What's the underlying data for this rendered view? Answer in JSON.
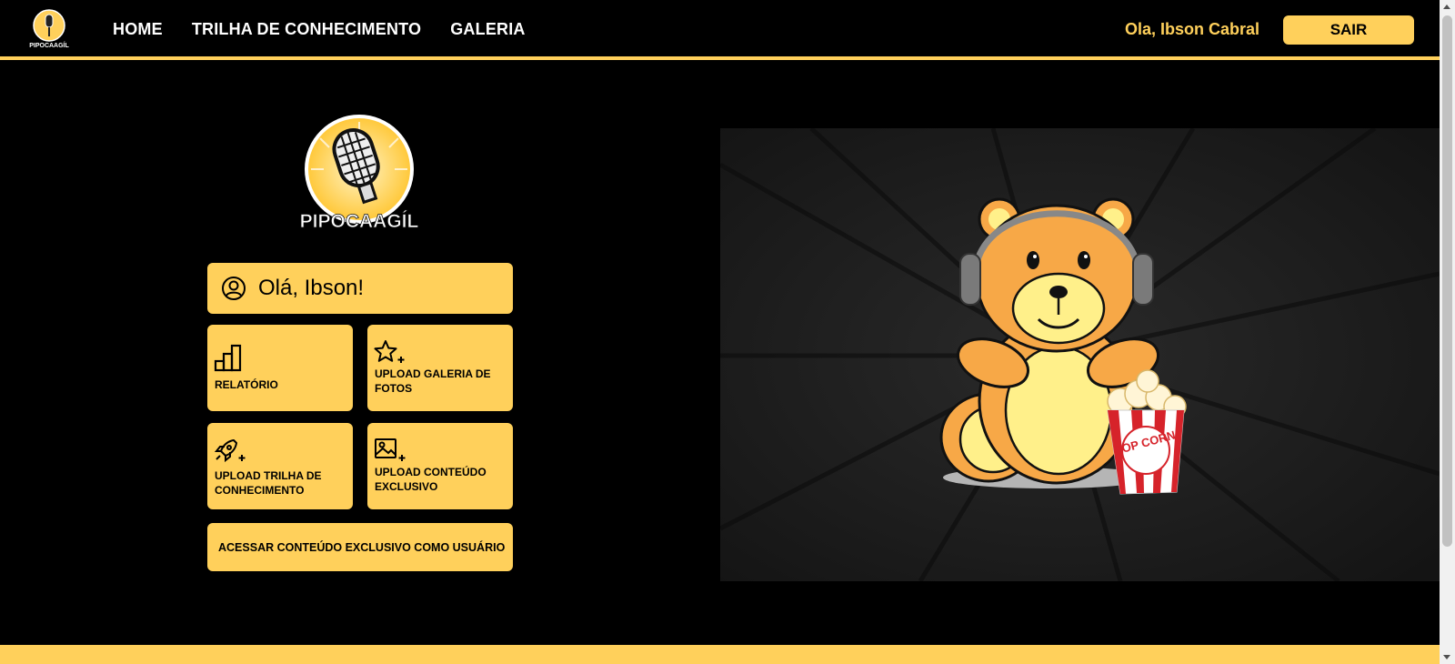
{
  "nav": {
    "links": [
      "HOME",
      "TRILHA DE CONHECIMENTO",
      "GALERIA"
    ],
    "greeting": "Ola, Ibson Cabral",
    "logout_label": "SAIR"
  },
  "brand": {
    "logo_text": "PIPOCAAGÍL"
  },
  "dashboard": {
    "greeting": "Olá, Ibson!",
    "tiles": {
      "report": "RELATÓRIO",
      "upload_gallery": "UPLOAD GALERIA DE FOTOS",
      "upload_trail": "UPLOAD TRILHA DE CONHECIMENTO",
      "upload_exclusive": "UPLOAD CONTEÚDO EXCLUSIVO"
    },
    "exclusive_access": "ACESSAR CONTEÚDO EXCLUSIVO COMO USUÁRIO"
  },
  "hero": {
    "popcorn_text": "POP CORN"
  },
  "colors": {
    "accent": "#FFD05B",
    "background": "#000000",
    "hero_background": "#1b1b1b"
  },
  "icons": [
    "person-circle-icon",
    "bar-chart-icon",
    "star-plus-icon",
    "rocket-plus-icon",
    "image-plus-icon"
  ]
}
